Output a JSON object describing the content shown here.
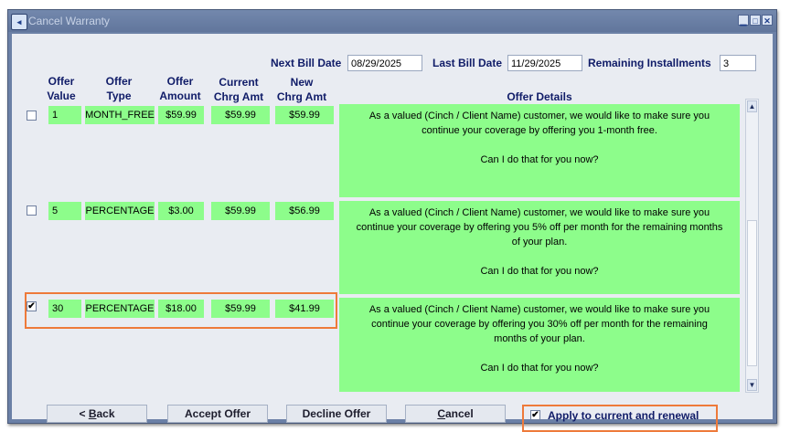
{
  "window": {
    "title": "Cancel Warranty",
    "minimize_glyph": "▁",
    "maximize_glyph": "□",
    "close_glyph": "✕",
    "icon": "app-icon"
  },
  "billing": {
    "next_bill_date_label": "Next Bill Date",
    "next_bill_date": "08/29/2025",
    "last_bill_date_label": "Last Bill Date",
    "last_bill_date": "11/29/2025",
    "remaining_installments_label": "Remaining Installments",
    "remaining_installments": "3"
  },
  "columns": {
    "offer_value": [
      "Offer",
      "Value"
    ],
    "offer_type": [
      "Offer",
      "Type"
    ],
    "offer_amount": [
      "Offer",
      "Amount"
    ],
    "current_chrg_amt": [
      "Current",
      "Chrg Amt"
    ],
    "new_chrg_amt": [
      "New",
      "Chrg Amt"
    ],
    "offer_details": "Offer Details"
  },
  "offers": [
    {
      "checked": false,
      "check_glyph": "",
      "value": "1",
      "type": "MONTH_FREE",
      "amount": "$59.99",
      "current": "$59.99",
      "new": "$59.99",
      "details_lines": [
        "As a valued (Cinch / Client Name) customer, we would like to make sure you",
        "continue your coverage by offering you 1-month free."
      ],
      "question": "Can I do that for you now?"
    },
    {
      "checked": false,
      "check_glyph": "",
      "value": "5",
      "type": "PERCENTAGE",
      "amount": "$3.00",
      "current": "$59.99",
      "new": "$56.99",
      "details_lines": [
        "As a valued (Cinch / Client Name) customer, we would like to make sure you",
        "continue your coverage by offering you 5% off per month for the remaining months",
        "of your plan."
      ],
      "question": "Can I do that for you now?"
    },
    {
      "checked": true,
      "check_glyph": "✔",
      "value": "30",
      "type": "PERCENTAGE",
      "amount": "$18.00",
      "current": "$59.99",
      "new": "$41.99",
      "details_lines": [
        "As a valued (Cinch / Client Name) customer, we would like to make sure you",
        "continue your coverage by offering you 30% off per month for the remaining",
        "months of your plan."
      ],
      "question": "Can I do that for you now?"
    }
  ],
  "scrollbar": {
    "up_glyph": "▲",
    "down_glyph": "▼"
  },
  "buttons": {
    "back_prefix": "< ",
    "back_mnemonic": "B",
    "back_rest": "ack",
    "accept": "Accept Offer",
    "decline": "Decline Offer",
    "cancel_mnemonic": "C",
    "cancel_rest": "ancel"
  },
  "apply": {
    "checked": true,
    "check_glyph": "✔",
    "label": "Apply to current and renewal"
  },
  "colors": {
    "offer_green": "#8dfd8b",
    "label_navy": "#101c68",
    "highlight_orange": "#ee7a3a",
    "title_bar": "#6b80a6"
  }
}
